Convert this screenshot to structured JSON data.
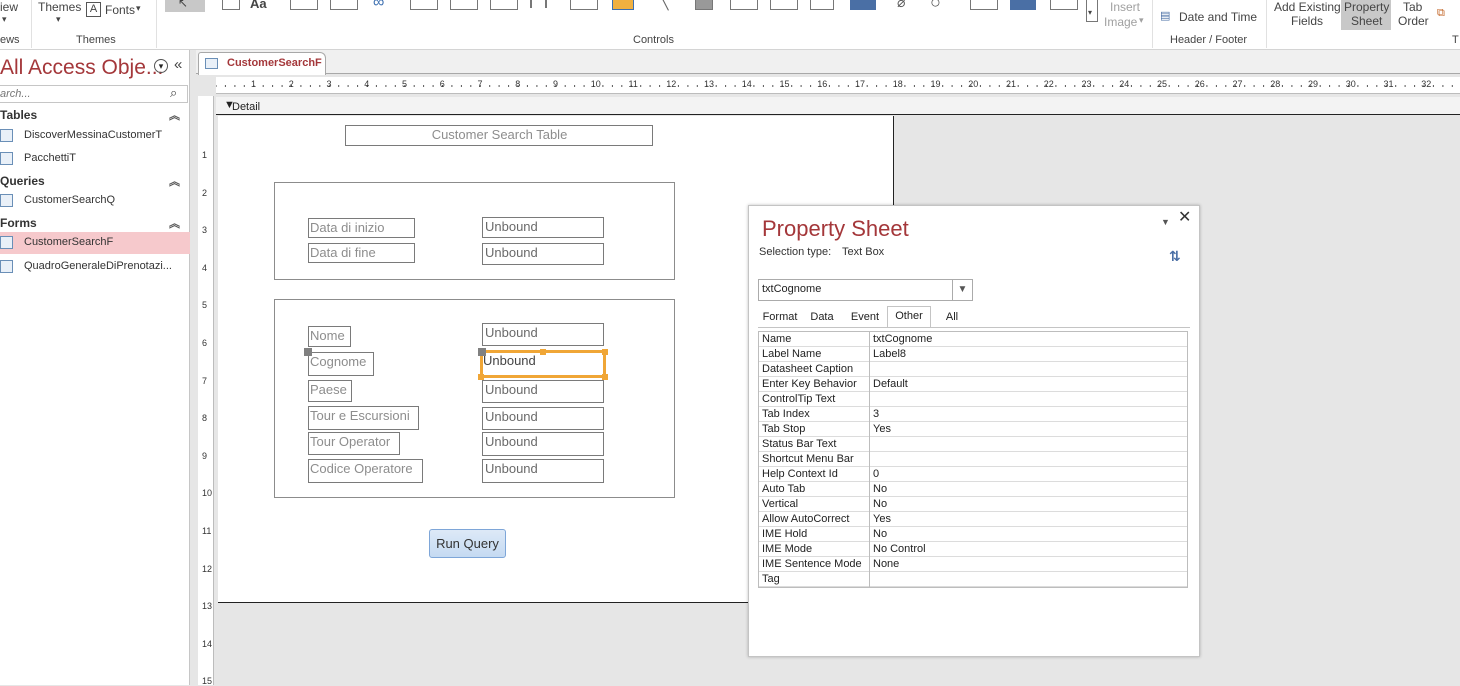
{
  "ribbon": {
    "views_label": "iew",
    "views_group": "ews",
    "themes_label": "Themes",
    "fonts_label": "Fonts",
    "themes_group": "Themes",
    "controls_group": "Controls",
    "insert_image_label_1": "Insert",
    "insert_image_label_2": "Image",
    "date_time_label": "Date and Time",
    "header_footer_group": "Header / Footer",
    "add_existing_fields_1": "Add Existing",
    "add_existing_fields_2": "Fields",
    "property_sheet_1": "Property",
    "property_sheet_2": "Sheet",
    "tab_order_1": "Tab",
    "tab_order_2": "Order",
    "tools_group": "T"
  },
  "nav": {
    "title": "All Access Obje...",
    "search_placeholder": "arch...",
    "sections": [
      {
        "label": "Tables",
        "items": [
          "DiscoverMessinaCustomerT",
          "PacchettiT"
        ]
      },
      {
        "label": "Queries",
        "items": [
          "CustomerSearchQ"
        ]
      },
      {
        "label": "Forms",
        "items": [
          "CustomerSearchF",
          "QuadroGeneraleDiPrenotazi..."
        ]
      }
    ],
    "selected_item": "CustomerSearchF"
  },
  "document": {
    "tab_label": "CustomerSearchF",
    "section_label": "Detail",
    "ruler_h": [
      "1",
      "2",
      "3",
      "4",
      "5",
      "6",
      "7",
      "8",
      "9",
      "10",
      "11",
      "12",
      "13",
      "14",
      "15",
      "16",
      "17",
      "18",
      "19",
      "20",
      "21",
      "22",
      "23",
      "24",
      "25",
      "26",
      "27",
      "28",
      "29",
      "30",
      "31",
      "32"
    ],
    "ruler_v": [
      "1",
      "2",
      "3",
      "4",
      "5",
      "6",
      "7",
      "8",
      "9",
      "10",
      "11",
      "12",
      "13",
      "14",
      "15"
    ]
  },
  "form": {
    "title": "Customer Search Table",
    "date_labels": [
      "Data di inizio",
      "Data di fine"
    ],
    "search_labels": [
      "Nome",
      "Cognome",
      "Paese",
      "Tour e Escursioni",
      "Tour Operator",
      "Codice Operatore"
    ],
    "unbound": "Unbound",
    "run_button": "Run Query"
  },
  "property_sheet": {
    "title": "Property Sheet",
    "selection_type_label": "Selection type:",
    "selection_type_value": "Text Box",
    "selected_control": "txtCognome",
    "tabs": [
      "Format",
      "Data",
      "Event",
      "Other",
      "All"
    ],
    "active_tab": "Other",
    "properties": [
      {
        "name": "Name",
        "value": "txtCognome"
      },
      {
        "name": "Label Name",
        "value": "Label8"
      },
      {
        "name": "Datasheet Caption",
        "value": ""
      },
      {
        "name": "Enter Key Behavior",
        "value": "Default"
      },
      {
        "name": "ControlTip Text",
        "value": ""
      },
      {
        "name": "Tab Index",
        "value": "3"
      },
      {
        "name": "Tab Stop",
        "value": "Yes"
      },
      {
        "name": "Status Bar Text",
        "value": ""
      },
      {
        "name": "Shortcut Menu Bar",
        "value": ""
      },
      {
        "name": "Help Context Id",
        "value": "0"
      },
      {
        "name": "Auto Tab",
        "value": "No"
      },
      {
        "name": "Vertical",
        "value": "No"
      },
      {
        "name": "Allow AutoCorrect",
        "value": "Yes"
      },
      {
        "name": "IME Hold",
        "value": "No"
      },
      {
        "name": "IME Mode",
        "value": "No Control"
      },
      {
        "name": "IME Sentence Mode",
        "value": "None"
      },
      {
        "name": "Tag",
        "value": ""
      }
    ]
  }
}
